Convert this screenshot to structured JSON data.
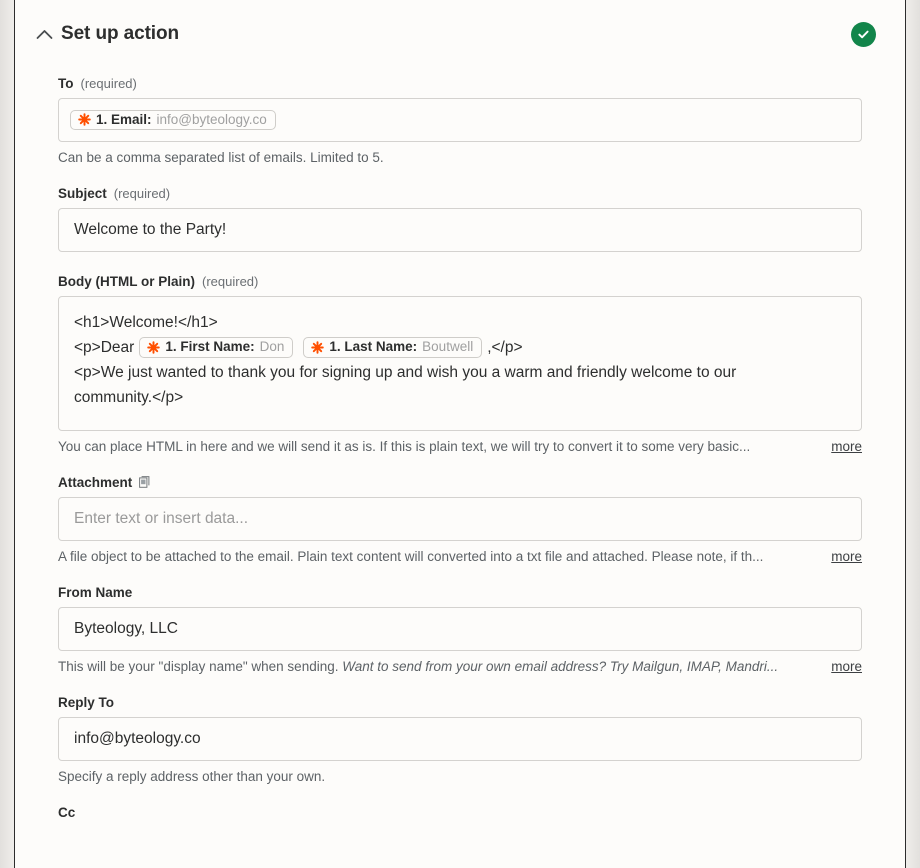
{
  "header": {
    "title": "Set up action",
    "collapse_icon": "chevron-up-icon",
    "status_icon": "check-circle-icon",
    "status_color": "#12854a"
  },
  "accent": {
    "zap_orange": "#ff4f00",
    "token_border": "#cfcdc9",
    "input_border": "#d4d2cf",
    "page_bg": "#fdfcfa"
  },
  "fields": {
    "to": {
      "label": "To",
      "required_text": "(required)",
      "token": {
        "icon": "zapier-asterisk-icon",
        "key": "1. Email:",
        "value": "info@byteology.co"
      },
      "help": "Can be a comma separated list of emails. Limited to 5.",
      "more_label": ""
    },
    "subject": {
      "label": "Subject",
      "required_text": "(required)",
      "value": "Welcome to the Party!"
    },
    "body": {
      "label": "Body (HTML or Plain)",
      "required_text": "(required)",
      "line1": "<h1>Welcome!</h1>",
      "line2_prefix": "<p>Dear",
      "line2_suffix": ",</p>",
      "token_first": {
        "icon": "zapier-asterisk-icon",
        "key": "1. First Name:",
        "value": "Don"
      },
      "token_last": {
        "icon": "zapier-asterisk-icon",
        "key": "1. Last Name:",
        "value": "Boutwell"
      },
      "line3": "<p>We just wanted to thank you for signing up and wish you a warm and friendly welcome to our",
      "line4": "community.</p>",
      "help": "You can place HTML in here and we will send it as is. If this is plain text, we will try to convert it to some very basic...",
      "more_label": "more"
    },
    "attachment": {
      "label": "Attachment",
      "label_icon": "file-document-icon",
      "placeholder": "Enter text or insert data...",
      "help": "A file object to be attached to the email. Plain text content will converted into a txt file and attached. Please note, if th...",
      "more_label": "more"
    },
    "from_name": {
      "label": "From Name",
      "value": "Byteology, LLC",
      "help_plain": "This will be your \"display name\" when sending. ",
      "help_italic": "Want to send from your own email address? Try Mailgun, IMAP, Mandri...",
      "more_label": "more"
    },
    "reply_to": {
      "label": "Reply To",
      "value": "info@byteology.co",
      "help": "Specify a reply address other than your own."
    },
    "cc": {
      "label": "Cc"
    }
  }
}
